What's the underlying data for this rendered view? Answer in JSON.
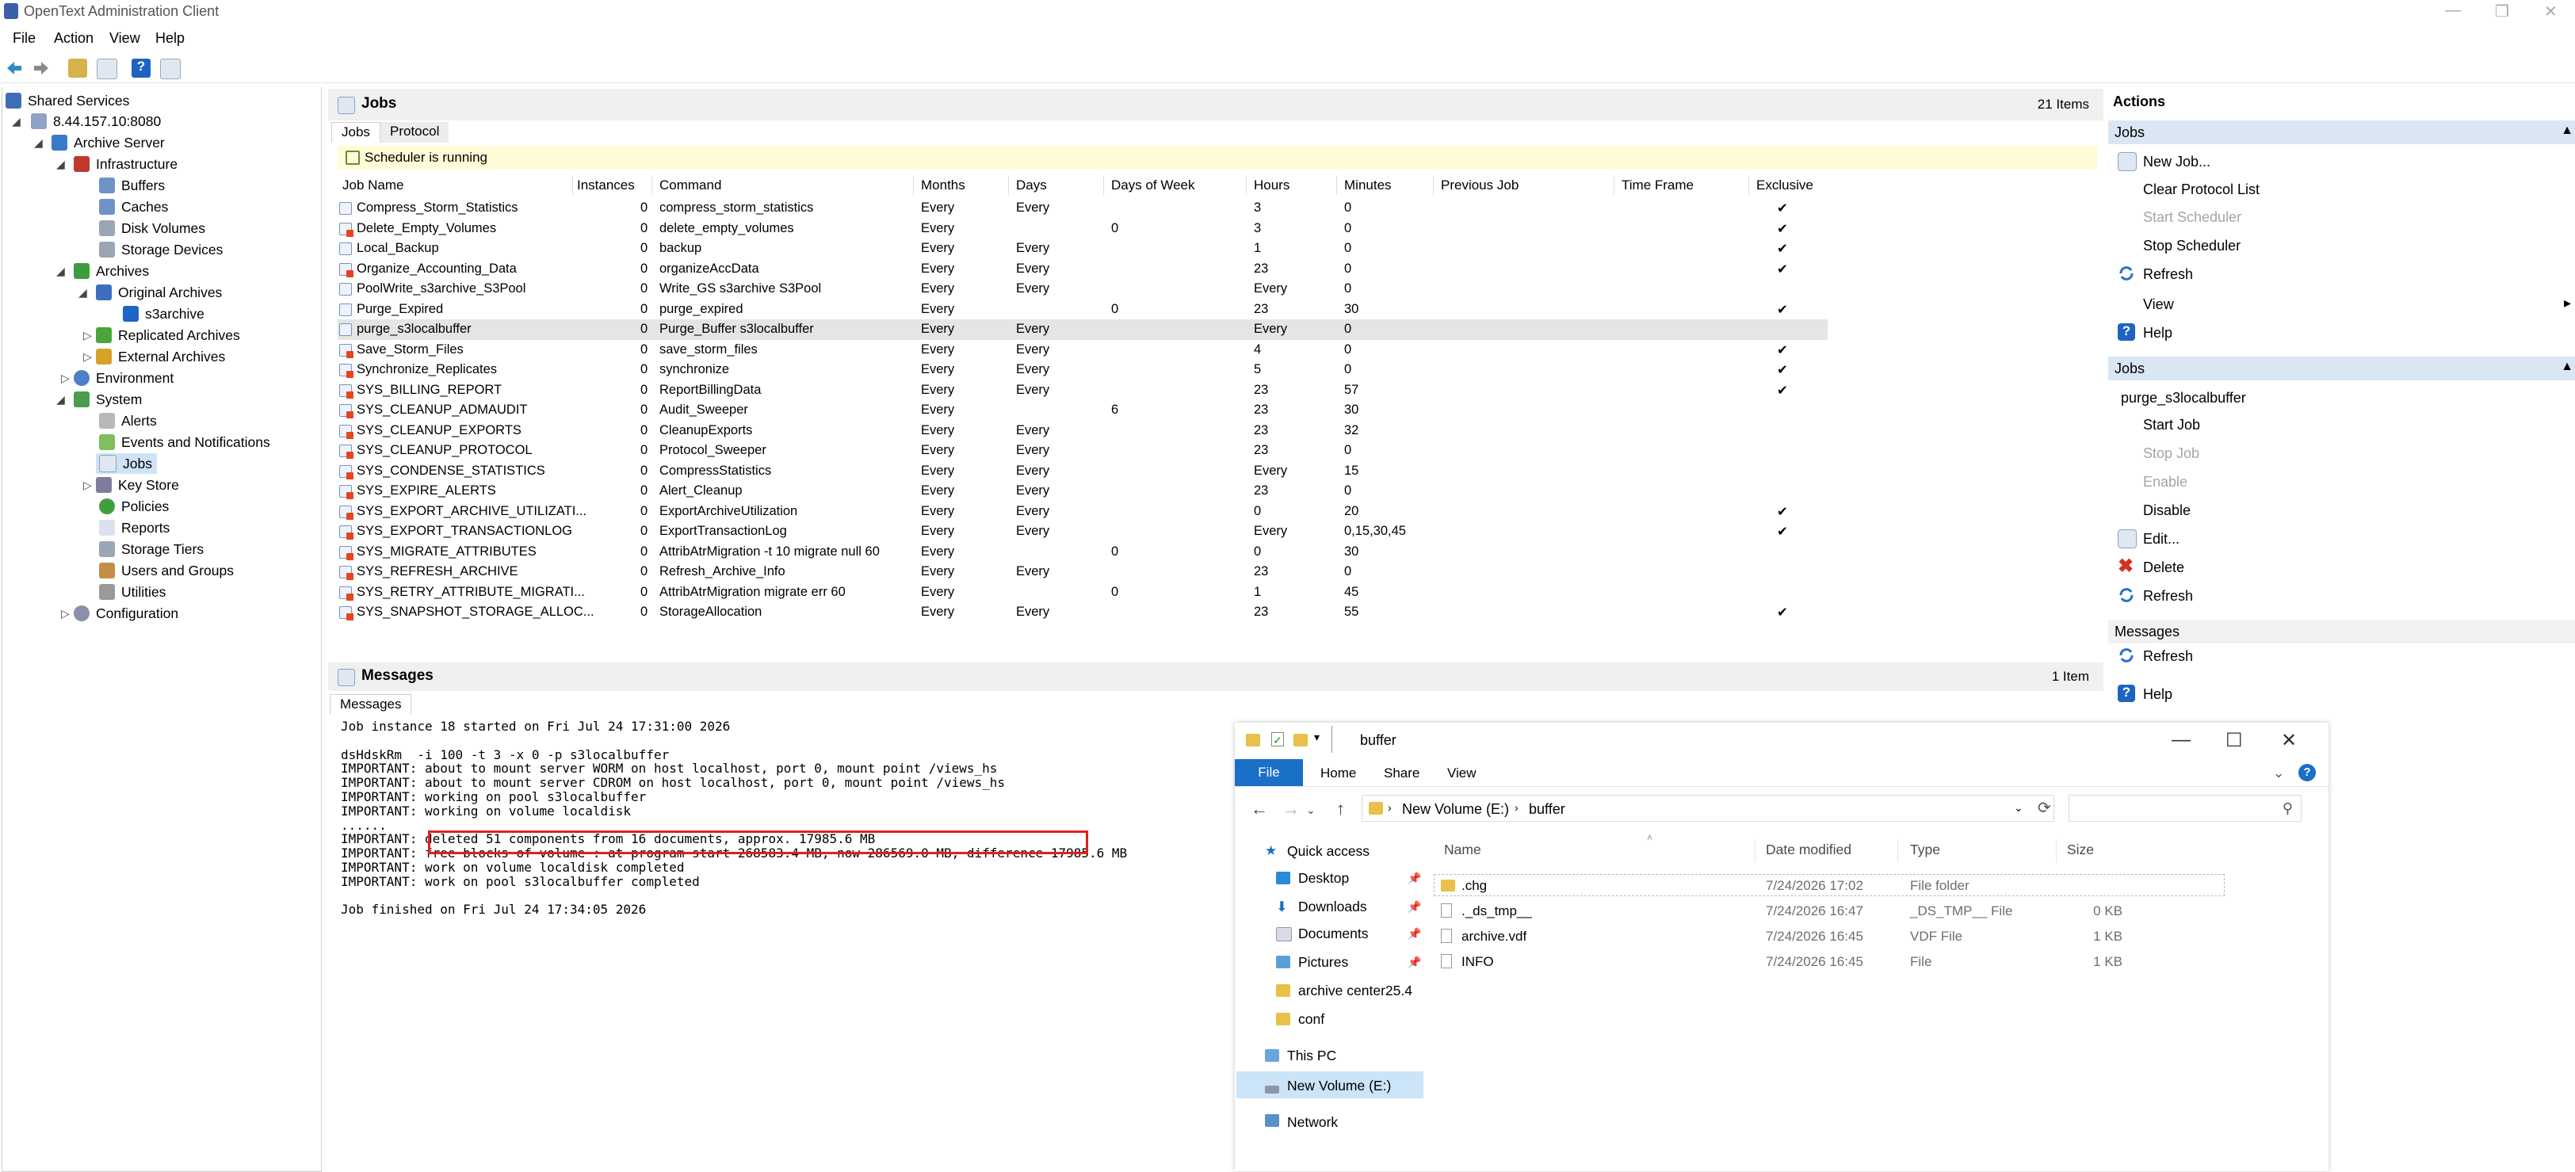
{
  "app": {
    "title": "OpenText Administration Client"
  },
  "menu": [
    "File",
    "Action",
    "View",
    "Help"
  ],
  "tree": {
    "root": "Shared Services",
    "server": "8.44.157.10:8080",
    "archive_server": "Archive Server",
    "infrastructure": "Infrastructure",
    "buffers": "Buffers",
    "caches": "Caches",
    "disk_volumes": "Disk Volumes",
    "storage_devices": "Storage Devices",
    "archives": "Archives",
    "original_archives": "Original Archives",
    "s3archive": "s3archive",
    "replicated_archives": "Replicated Archives",
    "external_archives": "External Archives",
    "environment": "Environment",
    "system": "System",
    "alerts": "Alerts",
    "events": "Events and Notifications",
    "jobs": "Jobs",
    "key_store": "Key Store",
    "policies": "Policies",
    "reports": "Reports",
    "storage_tiers": "Storage Tiers",
    "users_groups": "Users and Groups",
    "utilities": "Utilities",
    "configuration": "Configuration"
  },
  "jobs_panel": {
    "title": "Jobs",
    "count": "21 Items",
    "tabs": [
      "Jobs",
      "Protocol"
    ],
    "status": "Scheduler is running",
    "columns": [
      "Job Name",
      "Instances",
      "Command",
      "Months",
      "Days",
      "Days of Week",
      "Hours",
      "Minutes",
      "Previous Job",
      "Time Frame",
      "Exclusive"
    ],
    "rows": [
      {
        "name": "Compress_Storm_Statistics",
        "inst": "0",
        "cmd": "compress_storm_statistics",
        "months": "Every",
        "days": "Every",
        "dow": "",
        "hours": "3",
        "minutes": "0",
        "prev": "",
        "tf": "",
        "excl": "✔",
        "red": false
      },
      {
        "name": "Delete_Empty_Volumes",
        "inst": "0",
        "cmd": "delete_empty_volumes",
        "months": "Every",
        "days": "",
        "dow": "0",
        "hours": "3",
        "minutes": "0",
        "prev": "",
        "tf": "",
        "excl": "✔",
        "red": true
      },
      {
        "name": "Local_Backup",
        "inst": "0",
        "cmd": "backup",
        "months": "Every",
        "days": "Every",
        "dow": "",
        "hours": "1",
        "minutes": "0",
        "prev": "",
        "tf": "",
        "excl": "✔",
        "red": false
      },
      {
        "name": "Organize_Accounting_Data",
        "inst": "0",
        "cmd": "organizeAccData",
        "months": "Every",
        "days": "Every",
        "dow": "",
        "hours": "23",
        "minutes": "0",
        "prev": "",
        "tf": "",
        "excl": "✔",
        "red": true
      },
      {
        "name": "PoolWrite_s3archive_S3Pool",
        "inst": "0",
        "cmd": "Write_GS s3archive S3Pool",
        "months": "Every",
        "days": "Every",
        "dow": "",
        "hours": "Every",
        "minutes": "0",
        "prev": "",
        "tf": "",
        "excl": "",
        "red": false
      },
      {
        "name": "Purge_Expired",
        "inst": "0",
        "cmd": "purge_expired",
        "months": "Every",
        "days": "",
        "dow": "0",
        "hours": "23",
        "minutes": "30",
        "prev": "",
        "tf": "",
        "excl": "✔",
        "red": false
      },
      {
        "name": "purge_s3localbuffer",
        "inst": "0",
        "cmd": "Purge_Buffer s3localbuffer",
        "months": "Every",
        "days": "Every",
        "dow": "",
        "hours": "Every",
        "minutes": "0",
        "prev": "",
        "tf": "",
        "excl": "",
        "red": false
      },
      {
        "name": "Save_Storm_Files",
        "inst": "0",
        "cmd": "save_storm_files",
        "months": "Every",
        "days": "Every",
        "dow": "",
        "hours": "4",
        "minutes": "0",
        "prev": "",
        "tf": "",
        "excl": "✔",
        "red": true
      },
      {
        "name": "Synchronize_Replicates",
        "inst": "0",
        "cmd": "synchronize",
        "months": "Every",
        "days": "Every",
        "dow": "",
        "hours": "5",
        "minutes": "0",
        "prev": "",
        "tf": "",
        "excl": "✔",
        "red": true
      },
      {
        "name": "SYS_BILLING_REPORT",
        "inst": "0",
        "cmd": "ReportBillingData",
        "months": "Every",
        "days": "Every",
        "dow": "",
        "hours": "23",
        "minutes": "57",
        "prev": "",
        "tf": "",
        "excl": "✔",
        "red": true
      },
      {
        "name": "SYS_CLEANUP_ADMAUDIT",
        "inst": "0",
        "cmd": "Audit_Sweeper",
        "months": "Every",
        "days": "",
        "dow": "6",
        "hours": "23",
        "minutes": "30",
        "prev": "",
        "tf": "",
        "excl": "",
        "red": true
      },
      {
        "name": "SYS_CLEANUP_EXPORTS",
        "inst": "0",
        "cmd": "CleanupExports",
        "months": "Every",
        "days": "Every",
        "dow": "",
        "hours": "23",
        "minutes": "32",
        "prev": "",
        "tf": "",
        "excl": "",
        "red": true
      },
      {
        "name": "SYS_CLEANUP_PROTOCOL",
        "inst": "0",
        "cmd": "Protocol_Sweeper",
        "months": "Every",
        "days": "Every",
        "dow": "",
        "hours": "23",
        "minutes": "0",
        "prev": "",
        "tf": "",
        "excl": "",
        "red": true
      },
      {
        "name": "SYS_CONDENSE_STATISTICS",
        "inst": "0",
        "cmd": "CompressStatistics",
        "months": "Every",
        "days": "Every",
        "dow": "",
        "hours": "Every",
        "minutes": "15",
        "prev": "",
        "tf": "",
        "excl": "",
        "red": true
      },
      {
        "name": "SYS_EXPIRE_ALERTS",
        "inst": "0",
        "cmd": "Alert_Cleanup",
        "months": "Every",
        "days": "Every",
        "dow": "",
        "hours": "23",
        "minutes": "0",
        "prev": "",
        "tf": "",
        "excl": "",
        "red": true
      },
      {
        "name": "SYS_EXPORT_ARCHIVE_UTILIZATI...",
        "inst": "0",
        "cmd": "ExportArchiveUtilization",
        "months": "Every",
        "days": "Every",
        "dow": "",
        "hours": "0",
        "minutes": "20",
        "prev": "",
        "tf": "",
        "excl": "✔",
        "red": true
      },
      {
        "name": "SYS_EXPORT_TRANSACTIONLOG",
        "inst": "0",
        "cmd": "ExportTransactionLog",
        "months": "Every",
        "days": "Every",
        "dow": "",
        "hours": "Every",
        "minutes": "0,15,30,45",
        "prev": "",
        "tf": "",
        "excl": "✔",
        "red": true
      },
      {
        "name": "SYS_MIGRATE_ATTRIBUTES",
        "inst": "0",
        "cmd": "AttribAtrMigration -t 10 migrate null 60",
        "months": "Every",
        "days": "",
        "dow": "0",
        "hours": "0",
        "minutes": "30",
        "prev": "",
        "tf": "",
        "excl": "",
        "red": true
      },
      {
        "name": "SYS_REFRESH_ARCHIVE",
        "inst": "0",
        "cmd": "Refresh_Archive_Info",
        "months": "Every",
        "days": "Every",
        "dow": "",
        "hours": "23",
        "minutes": "0",
        "prev": "",
        "tf": "",
        "excl": "",
        "red": true
      },
      {
        "name": "SYS_RETRY_ATTRIBUTE_MIGRATI...",
        "inst": "0",
        "cmd": "AttribAtrMigration migrate err 60",
        "months": "Every",
        "days": "",
        "dow": "0",
        "hours": "1",
        "minutes": "45",
        "prev": "",
        "tf": "",
        "excl": "",
        "red": true
      },
      {
        "name": "SYS_SNAPSHOT_STORAGE_ALLOC...",
        "inst": "0",
        "cmd": "StorageAllocation",
        "months": "Every",
        "days": "Every",
        "dow": "",
        "hours": "23",
        "minutes": "55",
        "prev": "",
        "tf": "",
        "excl": "✔",
        "red": true
      }
    ]
  },
  "messages_panel": {
    "title": "Messages",
    "count": "1 Item",
    "tab": "Messages",
    "lines": [
      "Job instance 18 started on Fri Jul 24 17:31:00 2026",
      "",
      "dsHdskRm  -i 100 -t 3 -x 0 -p s3localbuffer",
      "IMPORTANT: about to mount server WORM on host localhost, port 0, mount point /views_hs",
      "IMPORTANT: about to mount server CDROM on host localhost, port 0, mount point /views_hs",
      "IMPORTANT: working on pool s3localbuffer",
      "IMPORTANT: working on volume localdisk",
      "......",
      "IMPORTANT: deleted 51 components from 16 documents, approx. 17985.6 MB",
      "IMPORTANT: free blocks of volume : at program start 268583.4 MB, now 286569.0 MB, difference 17985.6 MB",
      "IMPORTANT: work on volume localdisk completed",
      "IMPORTANT: work on pool s3localbuffer completed",
      "",
      "Job finished on Fri Jul 24 17:34:05 2026"
    ]
  },
  "actions": {
    "title": "Actions",
    "section_jobs": "Jobs",
    "new_job": "New Job...",
    "clear_protocol": "Clear Protocol List",
    "start_scheduler": "Start Scheduler",
    "stop_scheduler": "Stop Scheduler",
    "refresh": "Refresh",
    "view": "View",
    "help": "Help",
    "section_jobs2": "Jobs",
    "selected_job": "purge_s3localbuffer",
    "start_job": "Start Job",
    "stop_job": "Stop Job",
    "enable": "Enable",
    "disable": "Disable",
    "edit": "Edit...",
    "delete": "Delete",
    "refresh2": "Refresh",
    "section_messages": "Messages",
    "refresh3": "Refresh",
    "help2": "Help"
  },
  "explorer": {
    "title": "buffer",
    "ribbon": [
      "File",
      "Home",
      "Share",
      "View"
    ],
    "address": [
      "New Volume (E:)",
      "buffer"
    ],
    "nav": {
      "quick_access": "Quick access",
      "desktop": "Desktop",
      "downloads": "Downloads",
      "documents": "Documents",
      "pictures": "Pictures",
      "archive_center": "archive center25.4",
      "conf": "conf",
      "this_pc": "This PC",
      "new_volume": "New Volume (E:)",
      "network": "Network"
    },
    "columns": [
      "Name",
      "Date modified",
      "Type",
      "Size"
    ],
    "files": [
      {
        "name": ".chg",
        "date": "7/24/2026 17:02",
        "type": "File folder",
        "size": "",
        "folder": true
      },
      {
        "name": "._ds_tmp__",
        "date": "7/24/2026 16:47",
        "type": "_DS_TMP__ File",
        "size": "0 KB",
        "folder": false
      },
      {
        "name": "archive.vdf",
        "date": "7/24/2026 16:45",
        "type": "VDF File",
        "size": "1 KB",
        "folder": false
      },
      {
        "name": "INFO",
        "date": "7/24/2026 16:45",
        "type": "File",
        "size": "1 KB",
        "folder": false
      }
    ]
  },
  "colors": {
    "accent": "#1a6fc6",
    "selection": "#cce4f7",
    "highlight_box": "#e02020",
    "status_bar": "#fffbd6",
    "section": "#dbe6f4"
  }
}
